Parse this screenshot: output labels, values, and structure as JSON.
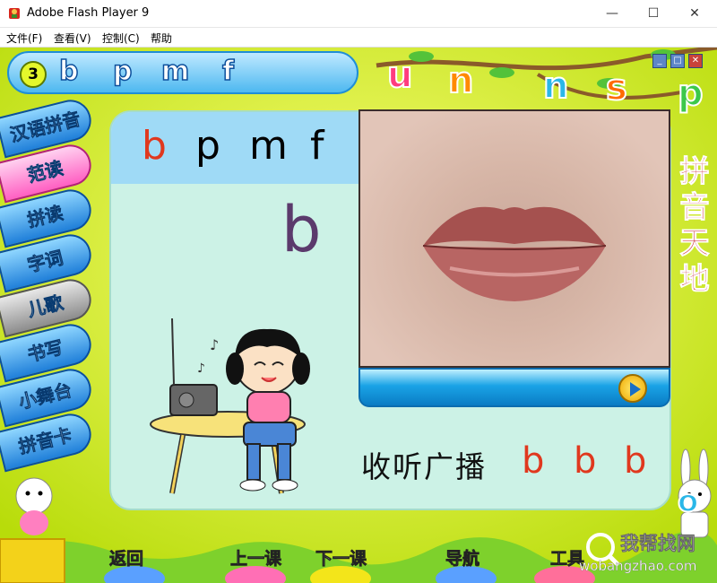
{
  "window": {
    "title": "Adobe Flash Player 9",
    "minimize": "—",
    "maximize": "☐",
    "close": "✕"
  },
  "menu": [
    "文件(F)",
    "查看(V)",
    "控制(C)",
    "帮助"
  ],
  "lesson": {
    "number": "3",
    "letters": [
      "b",
      "p",
      "m",
      "f"
    ]
  },
  "side_menu": [
    "汉语拼音",
    "范读",
    "拼读",
    "字词",
    "儿歌",
    "书写",
    "小舞台",
    "拼音卡"
  ],
  "side_menu_active": "范读",
  "side_menu_disabled": "儿歌",
  "card": {
    "header_letters": [
      "b",
      "p",
      "m",
      "f"
    ],
    "big_letter": "b"
  },
  "listen": {
    "text": "收听广播",
    "letters": [
      "b",
      "b",
      "b"
    ]
  },
  "right_title": [
    "拼",
    "音",
    "天",
    "地"
  ],
  "deco_letters": [
    {
      "char": "u",
      "color": "#ff3c7e"
    },
    {
      "char": "n",
      "color": "#ff8a00"
    },
    {
      "char": "n",
      "color": "#2ab7e8"
    },
    {
      "char": "s",
      "color": "#ff6a00"
    },
    {
      "char": "p",
      "color": "#3cc84a"
    },
    {
      "char": "o",
      "color": "#2ab7e8"
    }
  ],
  "mini_controls": [
    "_",
    "□",
    "✕"
  ],
  "bottom_nav": [
    "返回",
    "上一课",
    "下一课",
    "导航",
    "工具"
  ],
  "watermark": {
    "main": "我帮找网",
    "sub": "wobangzhao.com"
  }
}
